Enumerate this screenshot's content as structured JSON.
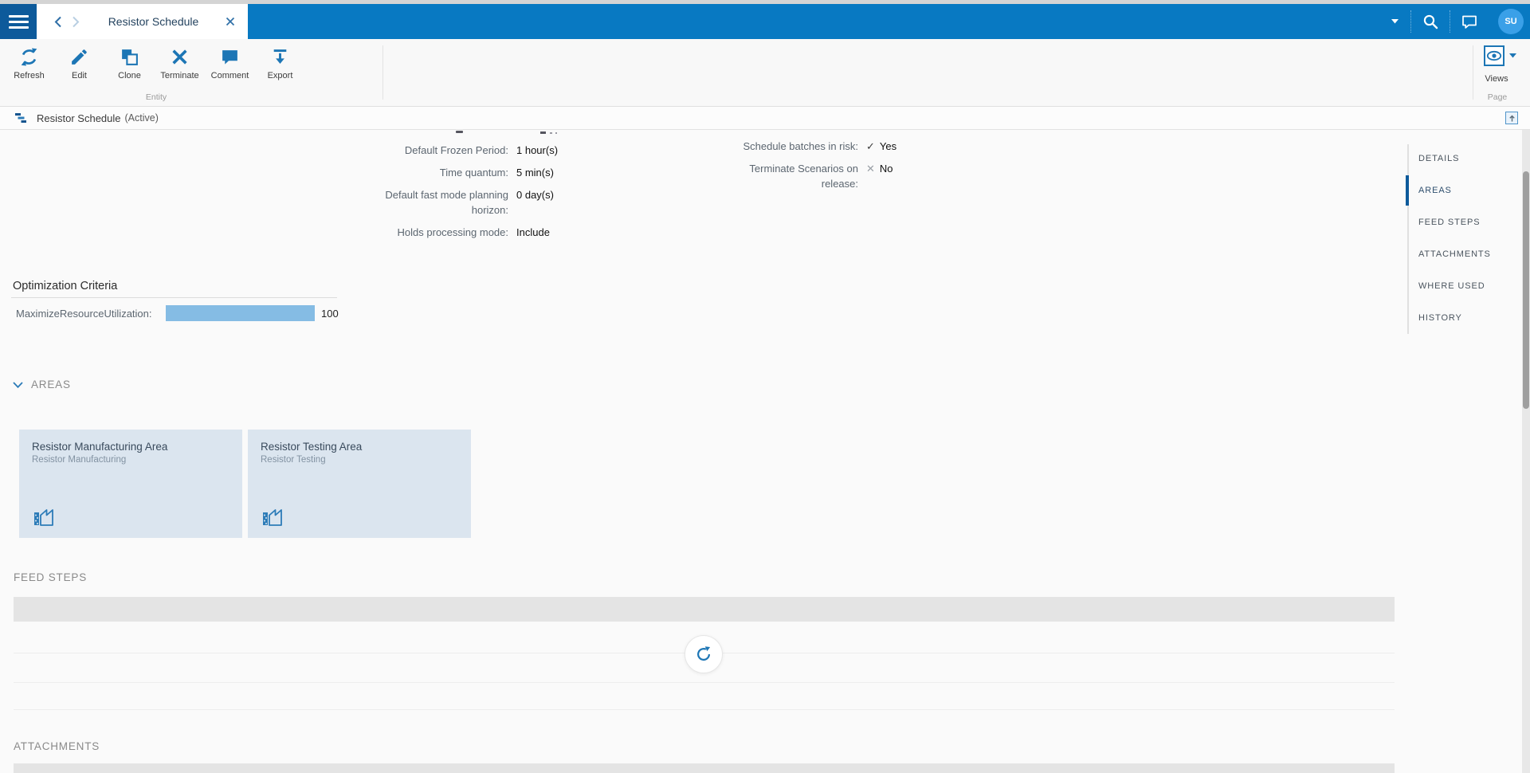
{
  "topbar": {
    "tab": {
      "title": "Resistor Schedule"
    },
    "avatar_initials": "SU"
  },
  "ribbon": {
    "entity_group": {
      "label": "Entity",
      "buttons": [
        {
          "label": "Refresh",
          "icon": "refresh-icon"
        },
        {
          "label": "Edit",
          "icon": "edit-icon"
        },
        {
          "label": "Clone",
          "icon": "clone-icon"
        },
        {
          "label": "Terminate",
          "icon": "terminate-icon"
        },
        {
          "label": "Comment",
          "icon": "comment-icon"
        },
        {
          "label": "Export",
          "icon": "export-icon"
        }
      ]
    },
    "page_group": {
      "label": "Page",
      "views_label": "Views",
      "views_icon": "eye-icon"
    }
  },
  "page_header": {
    "title": "Resistor Schedule",
    "status": "(Active)",
    "icon": "schedule-gantt-icon"
  },
  "details": {
    "left_fields": [
      {
        "label": "Default Frozen Period:",
        "value": "1 hour(s)"
      },
      {
        "label": "Time quantum:",
        "value": "5 min(s)"
      },
      {
        "label": "Default fast mode planning horizon:",
        "value": "0 day(s)"
      },
      {
        "label": "Holds processing mode:",
        "value": "Include"
      }
    ],
    "right_fields": [
      {
        "label": "Schedule batches in risk:",
        "value": "Yes",
        "icon": "check-icon"
      },
      {
        "label": "Terminate Scenarios on release:",
        "value": "No",
        "icon": "cross-icon"
      }
    ]
  },
  "optimization": {
    "title": "Optimization Criteria",
    "rows": [
      {
        "label": "MaximizeResourceUtilization:",
        "value": 100,
        "max": 100
      }
    ]
  },
  "areas": {
    "title": "AREAS",
    "cards": [
      {
        "title": "Resistor Manufacturing Area",
        "subtitle": "Resistor Manufacturing",
        "icon": "factory-icon"
      },
      {
        "title": "Resistor Testing Area",
        "subtitle": "Resistor Testing",
        "icon": "factory-icon"
      }
    ]
  },
  "feed_steps": {
    "title": "FEED STEPS",
    "loading_icon": "refresh-spinner-icon"
  },
  "attachments": {
    "title": "ATTACHMENTS"
  },
  "side_nav": {
    "items": [
      {
        "label": "DETAILS",
        "active": false
      },
      {
        "label": "AREAS",
        "active": true
      },
      {
        "label": "FEED STEPS",
        "active": false
      },
      {
        "label": "ATTACHMENTS",
        "active": false
      },
      {
        "label": "WHERE USED",
        "active": false
      },
      {
        "label": "HISTORY",
        "active": false
      }
    ]
  },
  "colors": {
    "top_bar": "#0879c2",
    "menu_square": "#0d5a9b",
    "accent_blue": "#1d76b5",
    "avatar_blue": "#3aa0e8",
    "card_bg": "#dbe5ef",
    "progress_fill": "#85bce4",
    "active_nav": "#0d5a9b"
  }
}
